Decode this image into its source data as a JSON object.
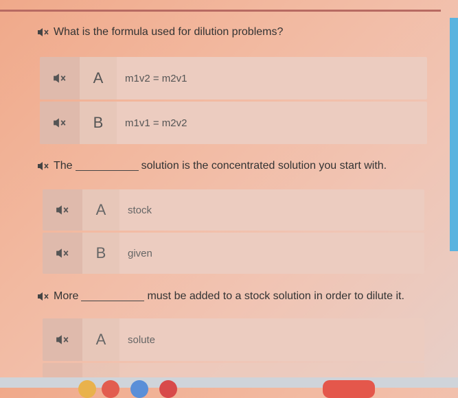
{
  "questions": [
    {
      "parts": [
        "What is the formula used for dilution problems?"
      ],
      "options": [
        {
          "letter": "A",
          "text": "m1v2 = m2v1"
        },
        {
          "letter": "B",
          "text": "m1v1 = m2v2"
        }
      ]
    },
    {
      "before": "The",
      "after": "solution is the concentrated solution you start with.",
      "options": [
        {
          "letter": "A",
          "text": "stock"
        },
        {
          "letter": "B",
          "text": "given"
        }
      ]
    },
    {
      "before": "More",
      "after": "must be added to a stock solution in order to dilute it.",
      "options": [
        {
          "letter": "A",
          "text": "solute"
        }
      ]
    }
  ],
  "icons": {
    "speaker": "speaker-muted-icon"
  },
  "colors": {
    "accent_bar": "#5ab3df",
    "top_rule": "#b76a62"
  }
}
